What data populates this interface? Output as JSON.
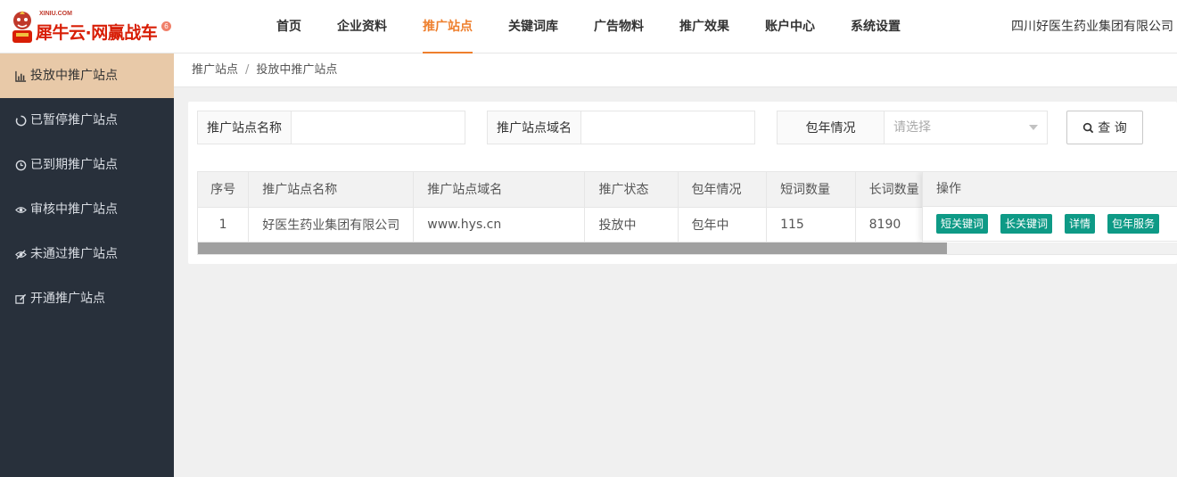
{
  "logo": {
    "small_text": "XINIU.COM",
    "brand_text": "犀牛云·网赢战车",
    "badge": "6"
  },
  "nav": {
    "items": [
      {
        "label": "首页"
      },
      {
        "label": "企业资料"
      },
      {
        "label": "推广站点",
        "active": true
      },
      {
        "label": "关键词库"
      },
      {
        "label": "广告物料"
      },
      {
        "label": "推广效果"
      },
      {
        "label": "账户中心"
      },
      {
        "label": "系统设置"
      }
    ],
    "company": "四川好医生药业集团有限公司"
  },
  "sidebar": {
    "items": [
      {
        "label": "投放中推广站点",
        "icon": "bar-chart-icon",
        "active": true
      },
      {
        "label": "已暂停推广站点",
        "icon": "circle-notch-icon"
      },
      {
        "label": "已到期推广站点",
        "icon": "clock-icon"
      },
      {
        "label": "审核中推广站点",
        "icon": "eye-icon"
      },
      {
        "label": "未通过推广站点",
        "icon": "eye-slash-icon"
      },
      {
        "label": "开通推广站点",
        "icon": "edit-icon"
      }
    ]
  },
  "breadcrumb": {
    "parent": "推广站点",
    "separator": "/",
    "current": "投放中推广站点"
  },
  "filters": {
    "name_label": "推广站点名称",
    "name_value": "",
    "domain_label": "推广站点域名",
    "domain_value": "",
    "yearly_label": "包年情况",
    "yearly_placeholder": "请选择",
    "query_label": "查 询"
  },
  "table": {
    "columns": [
      "序号",
      "推广站点名称",
      "推广站点域名",
      "推广状态",
      "包年情况",
      "短词数量",
      "长词数量",
      "操作"
    ],
    "rows": [
      {
        "index": "1",
        "name": "好医生药业集团有限公司",
        "domain": "www.hys.cn",
        "status": "投放中",
        "yearly": "包年中",
        "short_count": "115",
        "long_count": "8190"
      }
    ],
    "actions": [
      "短关键词",
      "长关键词",
      "详情",
      "包年服务"
    ]
  },
  "colors": {
    "accent": "#ee7f2d",
    "sidebar_bg": "#28303b",
    "sidebar_active": "#e8c9a8",
    "action_button": "#0e9a86"
  }
}
